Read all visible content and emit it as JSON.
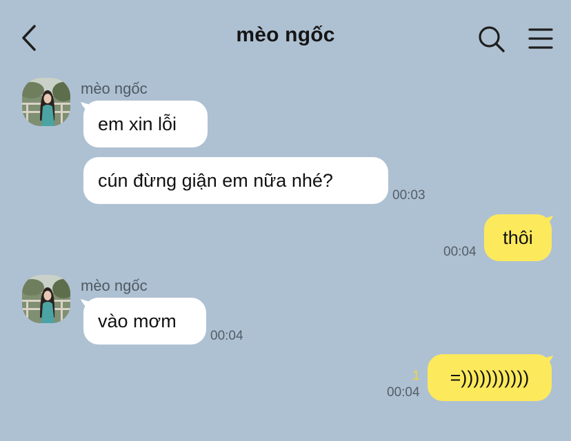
{
  "header": {
    "title": "mèo ngốc",
    "back_icon": "chevron-left-icon",
    "search_icon": "search-icon",
    "menu_icon": "hamburger-menu-icon"
  },
  "colors": {
    "background": "#aec1d2",
    "incoming_bubble": "#ffffff",
    "outgoing_bubble": "#fde95c",
    "unread_count": "#f2d633"
  },
  "messages": [
    {
      "direction": "incoming",
      "sender": "mèo ngốc",
      "bubbles": [
        {
          "text": "em xin lỗi"
        },
        {
          "text": "cún đừng giận em nữa nhé?",
          "time": "00:03"
        }
      ]
    },
    {
      "direction": "outgoing",
      "bubbles": [
        {
          "text": "thôi",
          "time": "00:04"
        }
      ]
    },
    {
      "direction": "incoming",
      "sender": "mèo ngốc",
      "bubbles": [
        {
          "text": "vào mơm",
          "time": "00:04"
        }
      ]
    },
    {
      "direction": "outgoing",
      "bubbles": [
        {
          "text": "=)))))))))))",
          "time": "00:04",
          "unread": "1"
        }
      ]
    }
  ]
}
